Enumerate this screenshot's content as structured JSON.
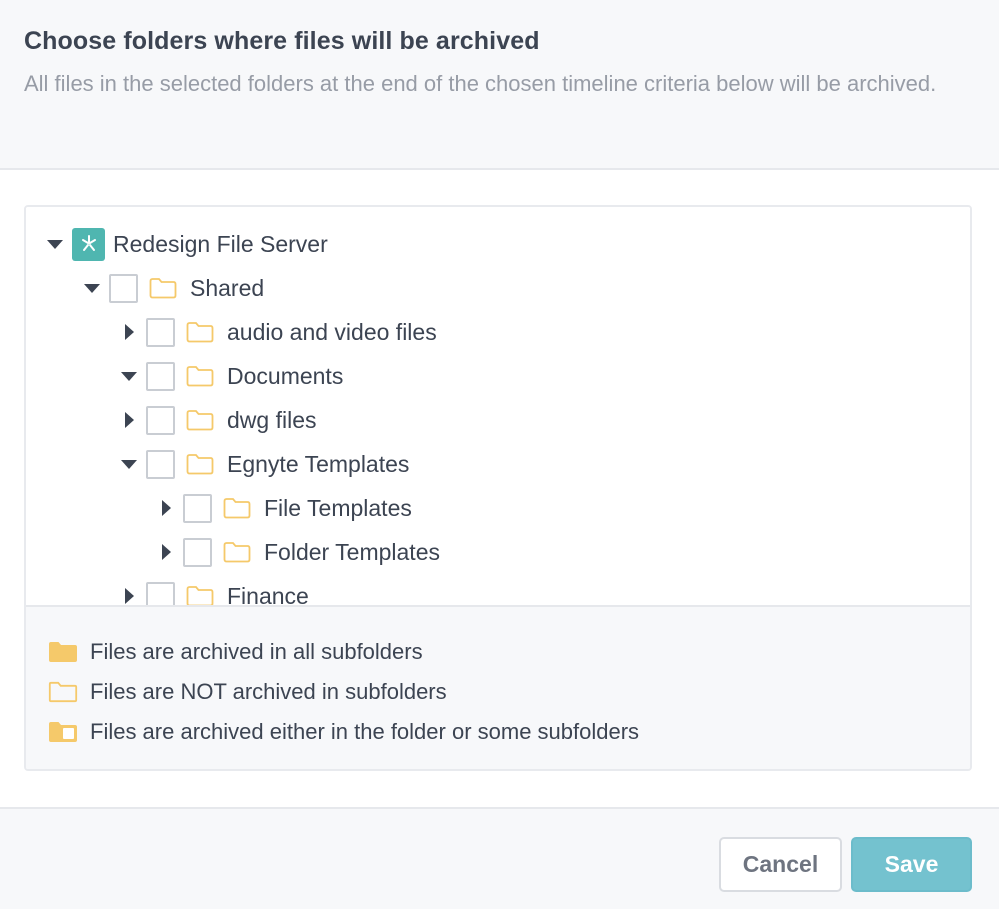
{
  "header": {
    "title": "Choose folders where files will be archived",
    "description": "All files in the selected folders at the end of the chosen timeline criteria below will be archived."
  },
  "tree": {
    "root": {
      "label": "Redesign File Server",
      "expanded": true,
      "icon": "server-logo-icon"
    },
    "items": [
      {
        "label": "Shared",
        "depth": 1,
        "expanded": true,
        "checked": false
      },
      {
        "label": "audio and video files",
        "depth": 2,
        "expanded": false,
        "checked": false
      },
      {
        "label": "Documents",
        "depth": 2,
        "expanded": true,
        "checked": false
      },
      {
        "label": "dwg files",
        "depth": 2,
        "expanded": false,
        "checked": false
      },
      {
        "label": "Egnyte Templates",
        "depth": 2,
        "expanded": true,
        "checked": false
      },
      {
        "label": "File Templates",
        "depth": 3,
        "expanded": false,
        "checked": false
      },
      {
        "label": "Folder Templates",
        "depth": 3,
        "expanded": false,
        "checked": false
      },
      {
        "label": "Finance",
        "depth": 2,
        "expanded": false,
        "checked": false
      }
    ]
  },
  "legend": {
    "all_subfolders": "Files are archived in all subfolders",
    "not_subfolders": "Files are NOT archived in subfolders",
    "partial": "Files are archived either in the folder or some subfolders"
  },
  "footer": {
    "cancel_label": "Cancel",
    "save_label": "Save"
  },
  "colors": {
    "accent": "#74c2cf",
    "folder": "#f5c96a",
    "logo": "#4fb6b0"
  }
}
